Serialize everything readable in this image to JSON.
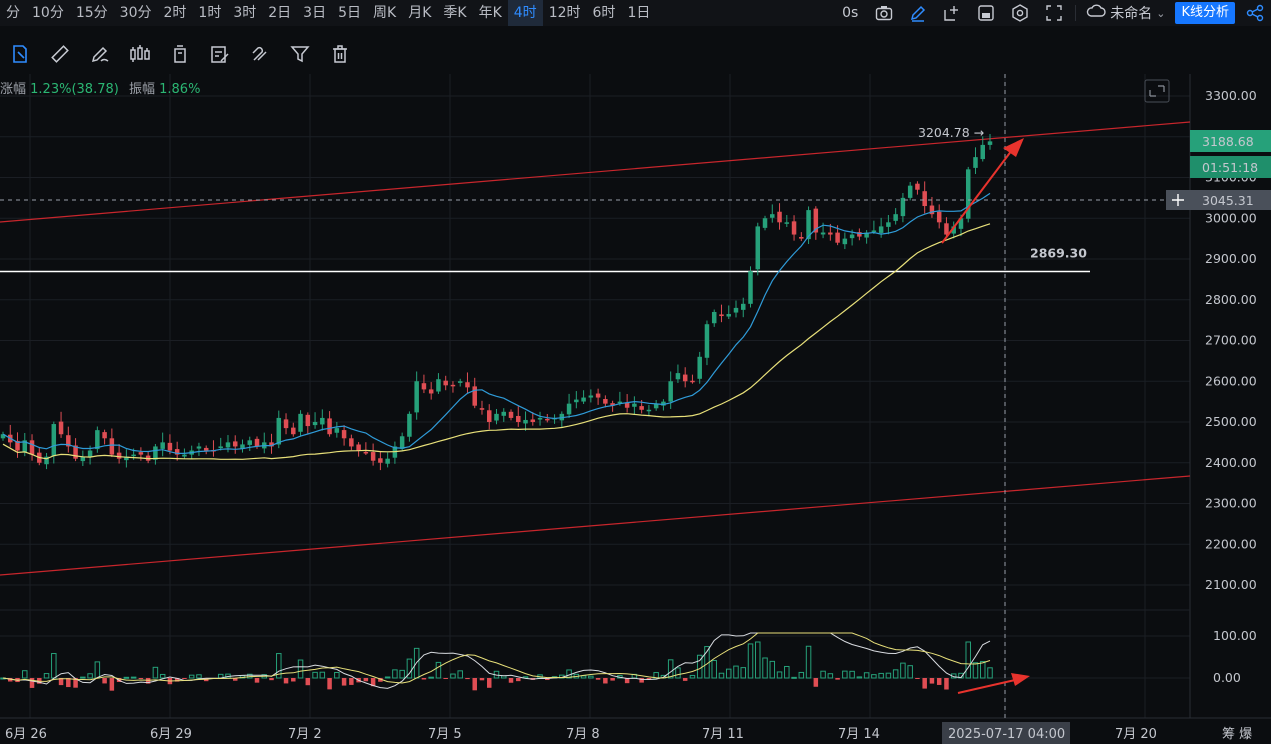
{
  "timeframes": [
    "分",
    "10分",
    "15分",
    "30分",
    "2时",
    "1时",
    "3时",
    "2日",
    "3日",
    "5日",
    "周K",
    "月K",
    "季K",
    "年K",
    "4时",
    "12时",
    "6时",
    "1日"
  ],
  "active_timeframe": "4时",
  "top_right": {
    "countdown_label": "0s",
    "layout_name": "未命名",
    "analysis_button": "K线分析"
  },
  "icons": {
    "toolbar": [
      "cursor-icon",
      "ruler-icon",
      "pen-icon",
      "candles-icon",
      "trash-bin-icon",
      "edit-note-icon",
      "magnet-icon",
      "filter-icon",
      "delete-icon"
    ]
  },
  "info_line": {
    "change_label": "涨幅",
    "change_value": "1.23%(38.78)",
    "amplitude_label": "振幅",
    "amplitude_value": "1.86%"
  },
  "price_axis": {
    "ticks": [
      "3300.00",
      "3200.00",
      "3100.00",
      "3000.00",
      "2900.00",
      "2800.00",
      "2700.00",
      "2600.00",
      "2500.00",
      "2400.00",
      "2300.00",
      "2200.00",
      "2100.00"
    ],
    "current_price": "3188.68",
    "countdown": "01:51:18",
    "crosshair_price": "3045.31"
  },
  "indicator_axis": {
    "ticks": [
      "100.00",
      "0.00"
    ]
  },
  "annotations": {
    "high_label": "3204.78 →",
    "support_label": "2869.30"
  },
  "time_axis": {
    "labels": [
      "6月 26",
      "6月 29",
      "7月 2",
      "7月 5",
      "7月 8",
      "7月 11",
      "7月 14",
      "2025-07-17 04:00",
      "7月 20"
    ],
    "corner_text": "筹 爆"
  },
  "colors": {
    "up": "#26a17a",
    "down": "#e04e54",
    "ma_fast": "#2f9bd8",
    "ma_slow": "#e8e07a",
    "channel": "#c8262c",
    "accent": "#1677ff"
  },
  "chart_data": {
    "type": "candlestick",
    "y_axis_range": [
      2050,
      3330
    ],
    "x_labels": [
      "6月 26",
      "6月 29",
      "7月 2",
      "7月 5",
      "7月 8",
      "7月 11",
      "7月 14",
      "7月 20"
    ],
    "closes": [
      2470,
      2450,
      2430,
      2455,
      2420,
      2400,
      2415,
      2495,
      2470,
      2440,
      2410,
      2415,
      2430,
      2480,
      2460,
      2420,
      2410,
      2415,
      2420,
      2420,
      2405,
      2440,
      2450,
      2430,
      2420,
      2420,
      2430,
      2440,
      2430,
      2430,
      2440,
      2450,
      2440,
      2445,
      2455,
      2440,
      2450,
      2440,
      2510,
      2485,
      2470,
      2520,
      2490,
      2500,
      2510,
      2470,
      2485,
      2460,
      2440,
      2430,
      2425,
      2405,
      2400,
      2410,
      2440,
      2465,
      2520,
      2600,
      2580,
      2570,
      2605,
      2590,
      2590,
      2600,
      2585,
      2540,
      2530,
      2500,
      2520,
      2525,
      2510,
      2500,
      2505,
      2500,
      2510,
      2505,
      2510,
      2520,
      2545,
      2555,
      2560,
      2565,
      2560,
      2545,
      2540,
      2550,
      2535,
      2545,
      2530,
      2530,
      2545,
      2550,
      2600,
      2620,
      2600,
      2600,
      2660,
      2740,
      2770,
      2760,
      2765,
      2780,
      2790,
      2870,
      2980,
      3000,
      3010,
      2990,
      2990,
      2960,
      2950,
      3020,
      2965,
      2965,
      2960,
      2940,
      2950,
      2960,
      2955,
      2965,
      2970,
      2980,
      2990,
      3010,
      3050,
      3080,
      3070,
      3030,
      3010,
      2990,
      2960,
      2980,
      3000,
      3120,
      3150,
      3180,
      3188.68
    ]
  }
}
